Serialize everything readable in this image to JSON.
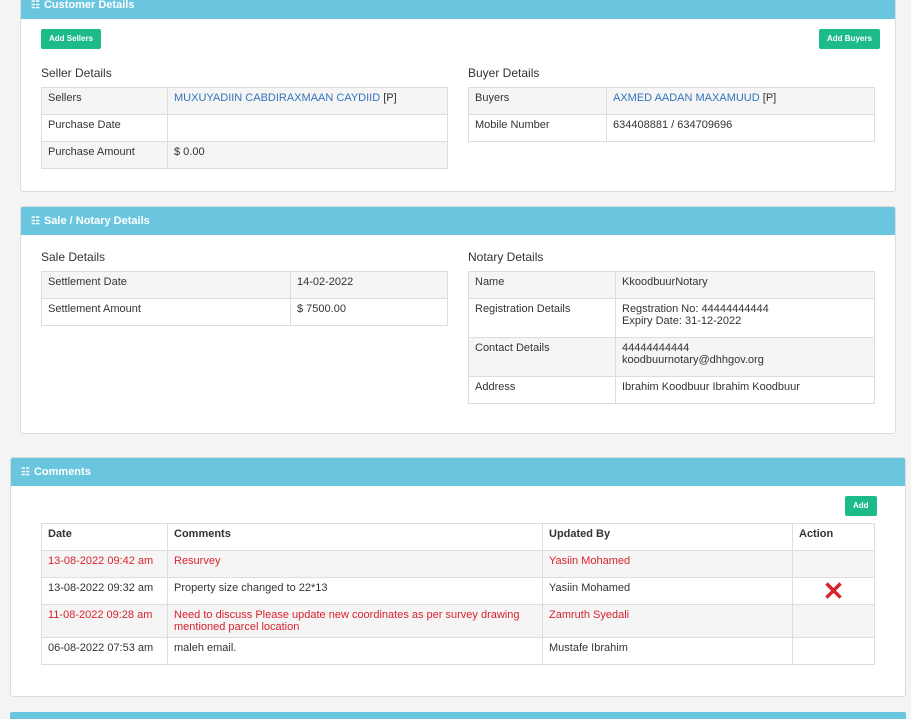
{
  "customer": {
    "title": "Customer Details",
    "add_sellers": "Add Sellers",
    "add_buyers": "Add Buyers",
    "seller_title": "Seller Details",
    "buyer_title": "Buyer Details",
    "seller_rows": [
      {
        "label": "Sellers",
        "value": "MUXUYADIIN CABDIRAXMAAN CAYDIID",
        "suffix": " [P]"
      },
      {
        "label": "Purchase Date",
        "value": ""
      },
      {
        "label": "Purchase Amount",
        "value": "$ 0.00"
      }
    ],
    "buyer_rows": [
      {
        "label": "Buyers",
        "value": "AXMED AADAN MAXAMUUD",
        "suffix": " [P]"
      },
      {
        "label": "Mobile Number",
        "value": "634408881 / 634709696"
      }
    ]
  },
  "sale": {
    "title": "Sale / Notary Details",
    "sale_title": "Sale Details",
    "notary_title": "Notary Details",
    "sale_rows": [
      {
        "label": "Settlement Date",
        "value": "14-02-2022"
      },
      {
        "label": "Settlement Amount",
        "value": "$ 7500.00"
      }
    ],
    "notary_rows": [
      {
        "label": "Name",
        "value": "KkoodbuurNotary"
      },
      {
        "label": "Registration Details",
        "line1": "Regstration No: 44444444444",
        "line2": "Expiry Date: 31-12-2022"
      },
      {
        "label": "Contact Details",
        "line1": "44444444444",
        "line2": "koodbuurnotary@dhhgov.org"
      },
      {
        "label": "Address",
        "value": "Ibrahim Koodbuur Ibrahim Koodbuur"
      }
    ]
  },
  "comments": {
    "title": "Comments",
    "add": "Add",
    "headers": [
      "Date",
      "Comments",
      "Updated By",
      "Action"
    ],
    "rows": [
      {
        "date": "13-08-2022 09:42 am",
        "comment": "Resurvey",
        "by": "Yasiin Mohamed"
      },
      {
        "date": "13-08-2022 09:32 am",
        "comment": "Property size changed to 22*13",
        "by": "Yasiin Mohamed",
        "action": "✕"
      },
      {
        "date": "11-08-2022 09:28 am",
        "comment": "Need to discuss Please update new coordinates as per survey drawing",
        "comment2": "mentioned parcel location",
        "by": "Zamruth Syedali"
      },
      {
        "date": "06-08-2022 07:53 am",
        "comment": "maleh email.",
        "by": "Mustafe Ibrahim"
      }
    ]
  },
  "icons": {
    "list": "☷"
  }
}
